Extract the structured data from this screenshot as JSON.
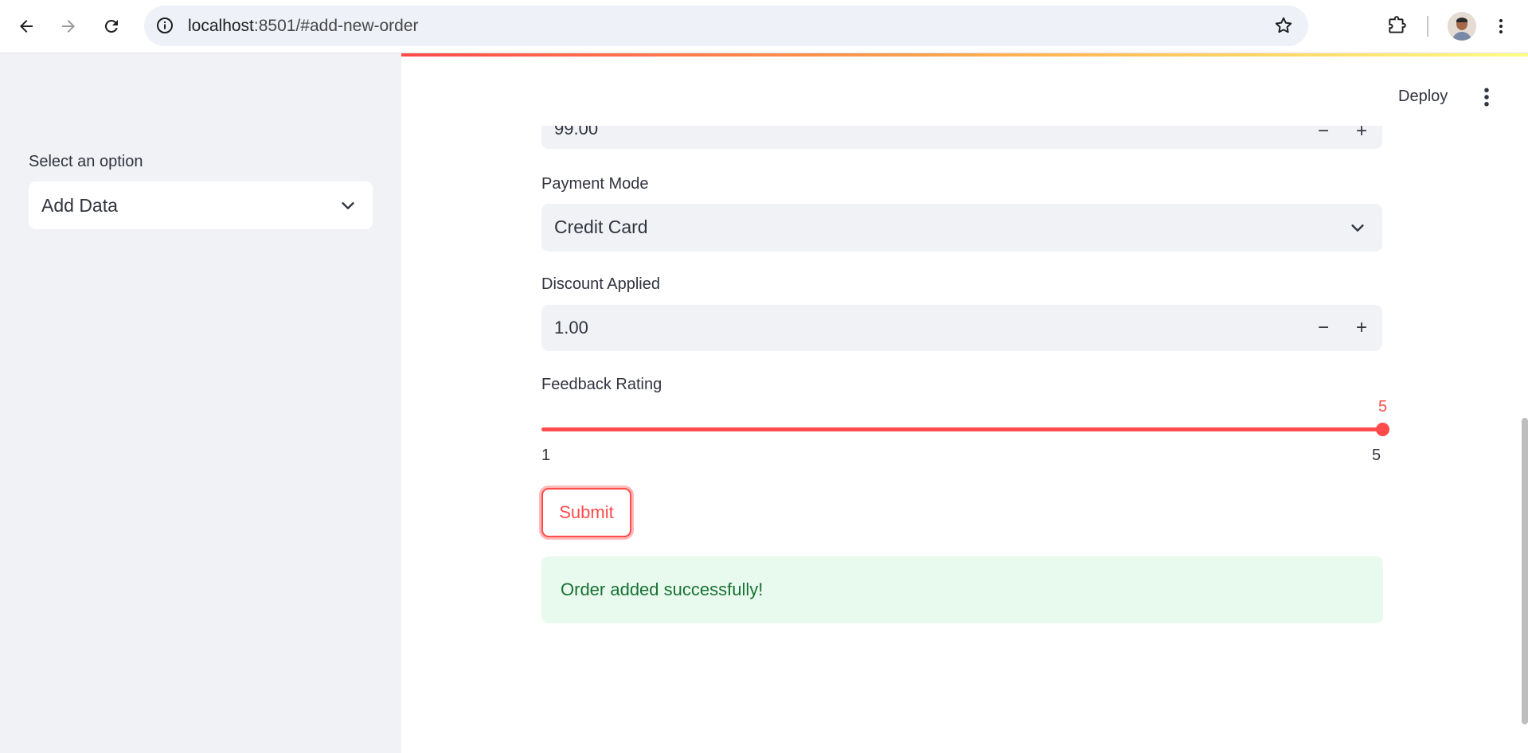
{
  "browser": {
    "url_host": "localhost",
    "url_rest": ":8501/#add-new-order"
  },
  "sidebar": {
    "select_label": "Select an option",
    "select_value": "Add Data"
  },
  "header": {
    "deploy_label": "Deploy"
  },
  "form": {
    "price_partial_value": "99.00",
    "payment_mode_label": "Payment Mode",
    "payment_mode_value": "Credit Card",
    "discount_label": "Discount Applied",
    "discount_value": "1.00",
    "rating_label": "Feedback Rating",
    "rating_value": "5",
    "rating_min": "1",
    "rating_max": "5",
    "submit_label": "Submit"
  },
  "status": {
    "success_message": "Order added successfully!"
  },
  "colors": {
    "primary": "#ff4b4b",
    "success_bg": "#e8f9ee",
    "success_text": "#177233"
  },
  "icons": [
    "back-arrow-icon",
    "forward-arrow-icon",
    "reload-icon",
    "site-info-icon",
    "bookmark-star-icon",
    "extensions-icon",
    "profile-avatar",
    "chrome-menu-icon",
    "chevron-down-icon",
    "app-menu-icon"
  ]
}
